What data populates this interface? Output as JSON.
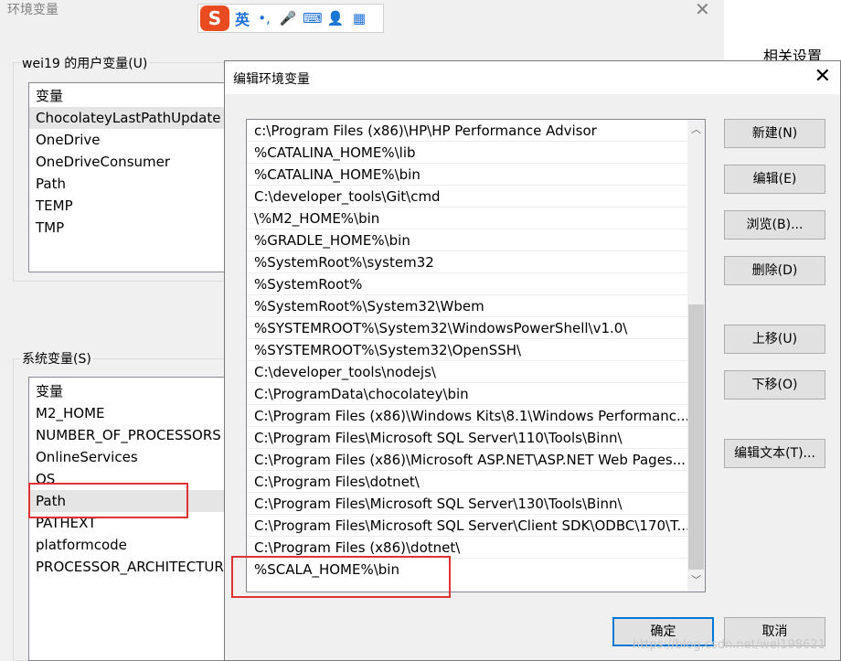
{
  "background_window": {
    "title": "环境变量",
    "close_glyph": "✕",
    "related_settings": "相关设置",
    "user_vars": {
      "label": "wei19 的用户变量(U)",
      "header": "变量",
      "rows": [
        "ChocolateyLastPathUpdate",
        "OneDrive",
        "OneDriveConsumer",
        "Path",
        "TEMP",
        "TMP"
      ]
    },
    "system_vars": {
      "label": "系统变量(S)",
      "header": "变量",
      "rows": [
        "M2_HOME",
        "NUMBER_OF_PROCESSORS",
        "OnlineServices",
        "OS",
        "Path",
        "PATHEXT",
        "platformcode",
        "PROCESSOR_ARCHITECTURE"
      ]
    }
  },
  "ime_toolbar": {
    "logo": "S",
    "language": "英",
    "icons": [
      "punctuation-icon",
      "microphone-icon",
      "keyboard-icon",
      "user-icon",
      "apps-icon"
    ],
    "punct_glyph": "•,",
    "mic_glyph": "🎤",
    "kbd_glyph": "⌨",
    "user_glyph": "👤",
    "apps_glyph": "▦"
  },
  "dialog": {
    "title": "编辑环境变量",
    "close_glyph": "✕",
    "paths": [
      "c:\\Program Files (x86)\\HP\\HP Performance Advisor",
      "%CATALINA_HOME%\\lib",
      "%CATALINA_HOME%\\bin",
      "C:\\developer_tools\\Git\\cmd",
      "\\%M2_HOME%\\bin",
      "%GRADLE_HOME%\\bin",
      "%SystemRoot%\\system32",
      "%SystemRoot%",
      "%SystemRoot%\\System32\\Wbem",
      "%SYSTEMROOT%\\System32\\WindowsPowerShell\\v1.0\\",
      "%SYSTEMROOT%\\System32\\OpenSSH\\",
      "C:\\developer_tools\\nodejs\\",
      "C:\\ProgramData\\chocolatey\\bin",
      "C:\\Program Files (x86)\\Windows Kits\\8.1\\Windows Performanc...",
      "C:\\Program Files\\Microsoft SQL Server\\110\\Tools\\Binn\\",
      "C:\\Program Files (x86)\\Microsoft ASP.NET\\ASP.NET Web Pages...",
      "C:\\Program Files\\dotnet\\",
      "C:\\Program Files\\Microsoft SQL Server\\130\\Tools\\Binn\\",
      "C:\\Program Files\\Microsoft SQL Server\\Client SDK\\ODBC\\170\\T...",
      "C:\\Program Files (x86)\\dotnet\\",
      "%SCALA_HOME%\\bin"
    ],
    "scroll_up_glyph": "︿",
    "scroll_down_glyph": "﹀",
    "buttons": {
      "new": "新建(N)",
      "edit": "编辑(E)",
      "browse": "浏览(B)...",
      "delete": "删除(D)",
      "move_up": "上移(U)",
      "move_down": "下移(O)",
      "edit_text": "编辑文本(T)...",
      "ok": "确定",
      "cancel": "取消"
    }
  },
  "watermark": "https://blog.csdn.net/wei198621",
  "colors": {
    "highlight_box": "#e03232",
    "default_button_border": "#0078d7",
    "ime_brand": "#e84b1f"
  }
}
